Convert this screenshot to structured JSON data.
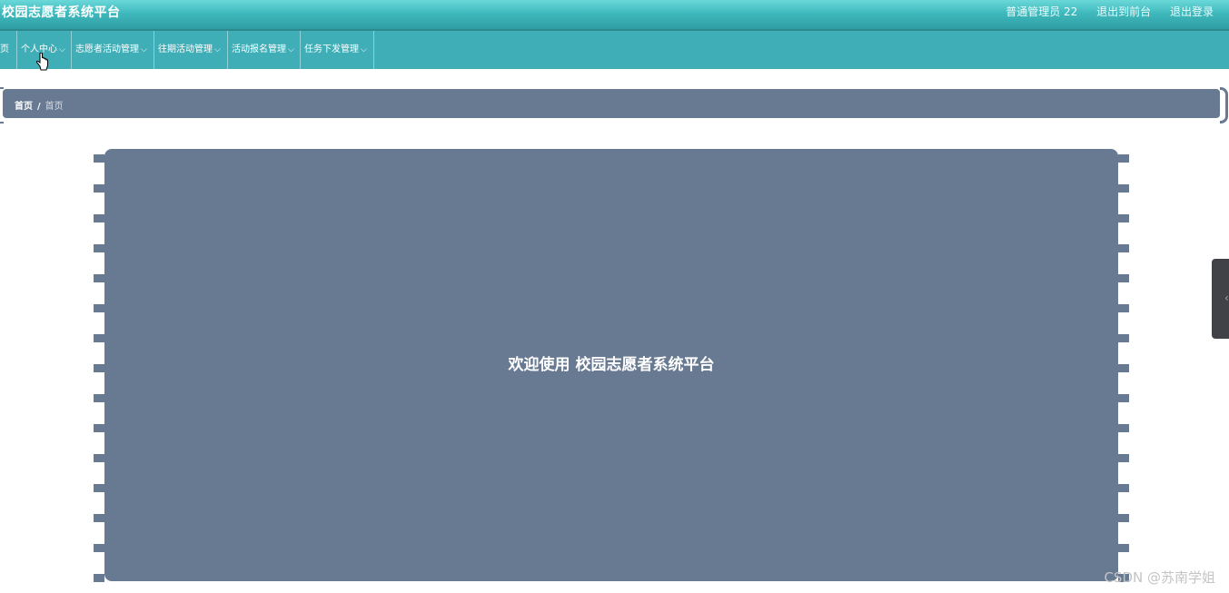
{
  "app": {
    "title": "校园志愿者系统平台"
  },
  "header": {
    "user_label": "普通管理员 22",
    "frontend_link": "退出到前台",
    "logout_link": "退出登录"
  },
  "nav": {
    "items": [
      {
        "label": "页"
      },
      {
        "label": "个人中心"
      },
      {
        "label": "志愿者活动管理"
      },
      {
        "label": "往期活动管理"
      },
      {
        "label": "活动报名管理"
      },
      {
        "label": "任务下发管理"
      }
    ]
  },
  "breadcrumb": {
    "home": "首页",
    "separator": "/",
    "current": "首页"
  },
  "main": {
    "welcome_text": "欢迎使用 校园志愿者系统平台"
  },
  "watermark": "CSDN @苏南学姐",
  "colors": {
    "header_teal": "#3fb9bd",
    "nav_teal": "#40aeb7",
    "panel_slate": "#687a92"
  }
}
